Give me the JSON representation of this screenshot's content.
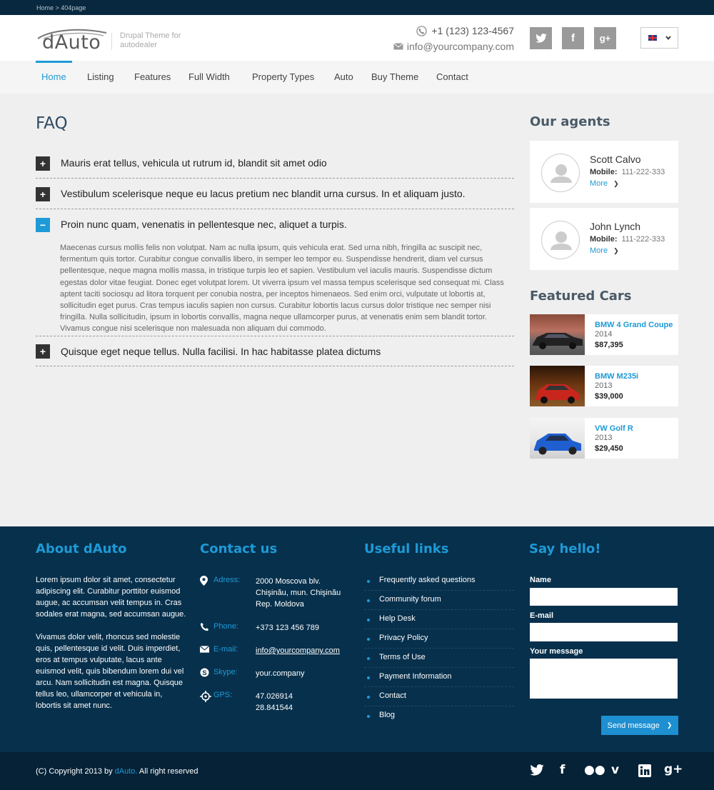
{
  "breadcrumb": "Home > 404page",
  "header": {
    "logo_text": "dAuto",
    "tagline": "Drupal Theme for autodealer",
    "phone": "+1 (123) 123-4567",
    "email": "info@yourcompany.com",
    "social": [
      "t",
      "f",
      "g+"
    ]
  },
  "nav": {
    "items": [
      "Home",
      "Listing",
      "Features",
      "Full Width",
      "Property Types",
      "Auto",
      "Buy Theme",
      "Contact"
    ],
    "active": "Home"
  },
  "faq": {
    "title": "FAQ",
    "items": [
      {
        "question": "Mauris erat tellus, vehicula ut rutrum id, blandit sit amet odio",
        "toggle": "+"
      },
      {
        "question": "Vestibulum scelerisque neque eu lacus pretium nec blandit urna cursus. In et aliquam justo.",
        "toggle": "+"
      },
      {
        "question": "Proin nunc quam, venenatis in pellentesque nec, aliquet a turpis.",
        "toggle": "−",
        "answer": "Maecenas cursus mollis felis non volutpat. Nam ac nulla ipsum, quis vehicula erat. Sed urna nibh, fringilla ac suscipit nec, fermentum quis tortor. Curabitur congue convallis libero, in semper leo tempor eu. Suspendisse hendrerit, diam vel cursus pellentesque, neque magna mollis massa, in tristique turpis leo et sapien. Vestibulum vel iaculis mauris. Suspendisse dictum egestas dolor vitae feugiat. Donec eget volutpat lorem. Ut viverra ipsum vel massa tempus scelerisque sed consequat mi. Class aptent taciti sociosqu ad litora torquent per conubia nostra, per inceptos himenaeos. Sed enim orci, vulputate ut lobortis at, sollicitudin eget purus. Cras tempus iaculis sapien non cursus. Curabitur lobortis lacus cursus dolor tristique nec semper nisi fringilla. Nulla sollicitudin, ipsum in lobortis convallis, magna neque ullamcorper purus, at venenatis enim sem blandit tortor. Vivamus congue nisi scelerisque non malesuada non aliquam dui commodo."
      },
      {
        "question": "Quisque eget neque tellus. Nulla facilisi. In hac habitasse platea dictums",
        "toggle": "+"
      }
    ]
  },
  "agents": {
    "title": "Our agents",
    "list": [
      {
        "name": "Scott Calvo",
        "mobile_label": "Mobile:",
        "mobile": "111-222-333",
        "more": "More"
      },
      {
        "name": "John Lynch",
        "mobile_label": "Mobile:",
        "mobile": "111-222-333",
        "more": "More"
      }
    ]
  },
  "featured": {
    "title": "Featured Cars",
    "cars": [
      {
        "name": "BMW 4 Grand Coupe",
        "year": "2014",
        "price": "$87,395",
        "color": "#222222"
      },
      {
        "name": "BMW M235i",
        "year": "2013",
        "price": "$39,000",
        "color": "#c8261d"
      },
      {
        "name": "VW Golf R",
        "year": "2013",
        "price": "$29,450",
        "color": "#1f5fd0"
      }
    ]
  },
  "footer": {
    "about": {
      "title": "About dAuto",
      "p1": "Lorem ipsum dolor sit amet, consectetur adipiscing elit. Curabitur porttitor euismod augue, ac accumsan velit tempus in. Cras sodales erat magna, sed accumsan augue.",
      "p2": "Vivamus dolor velit, rhoncus sed molestie quis, pellentesque id velit. Duis imperdiet, eros at tempus vulputate, lacus ante euismod velit, quis bibendum lorem dui vel arcu. Nam sollicitudin est magna. Quisque tellus leo, ullamcorper et vehicula in, lobortis sit amet nunc."
    },
    "contact": {
      "title": "Contact us",
      "address_label": "Adress:",
      "address": [
        "2000 Moscova blv.",
        "Chişinău, mun. Chişinău",
        "Rep. Moldova"
      ],
      "phone_label": "Phone:",
      "phone": "+373 123 456 789",
      "email_label": "E-mail:",
      "email": "info@yourcompany.com",
      "skype_label": "Skype:",
      "skype": "your.company",
      "gps_label": "GPS:",
      "gps": [
        "47.026914",
        "28.841544"
      ]
    },
    "links": {
      "title": "Useful links",
      "items": [
        "Frequently asked questions",
        "Community forum",
        "Help Desk",
        "Privacy Policy",
        "Terms of Use",
        "Payment Information",
        "Contact",
        "Blog"
      ]
    },
    "form": {
      "title": "Say hello!",
      "name_label": "Name",
      "email_label": "E-mail",
      "message_label": "Your message",
      "button": "Send message"
    }
  },
  "bottom": {
    "copyright_pre": "(C) Copyright 2013 by ",
    "copyright_brand": "dAuto.",
    "copyright_post": " All right reserved",
    "social": [
      "twitter",
      "facebook",
      "flickr",
      "vimeo",
      "linkedin",
      "google-plus"
    ]
  },
  "colors": {
    "accent": "#1e9ad6",
    "footer_bg": "#07304c",
    "bottom_bg": "#052237"
  }
}
